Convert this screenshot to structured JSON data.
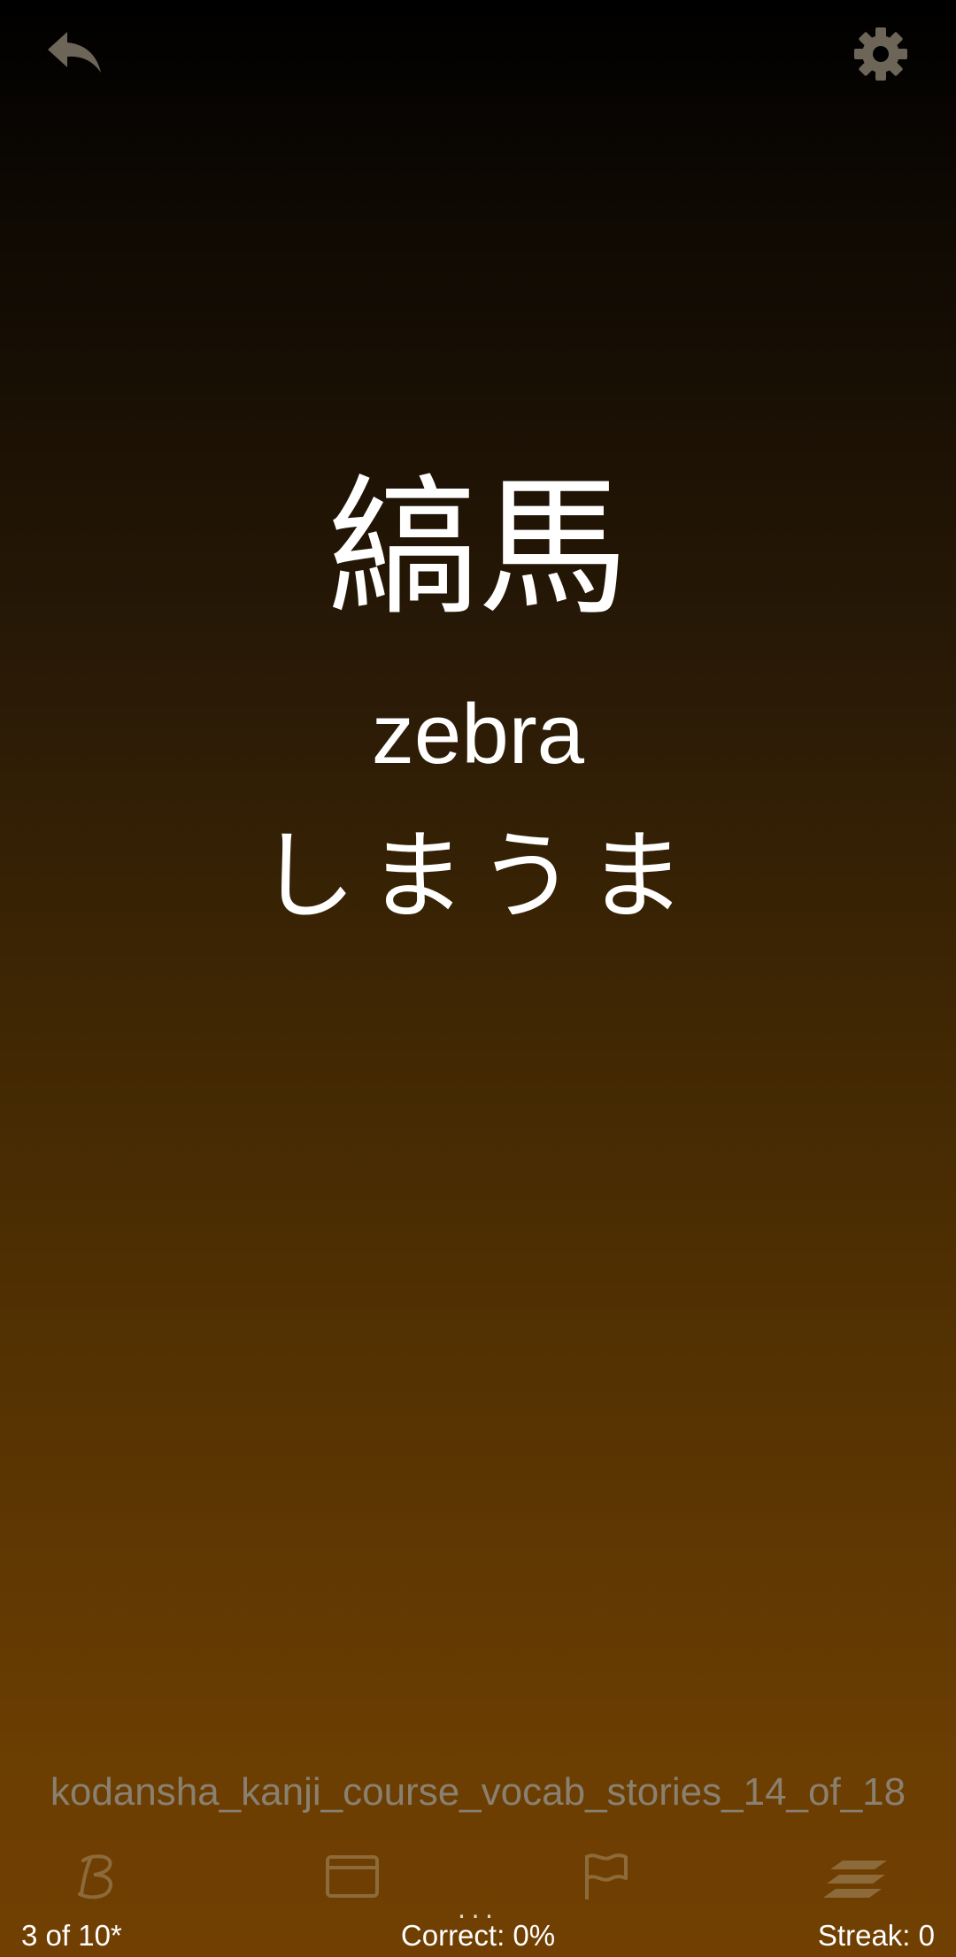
{
  "card": {
    "kanji": "縞馬",
    "meaning": "zebra",
    "reading": "しまうま"
  },
  "deck": {
    "name": "kodansha_kanji_course_vocab_stories_14_of_18"
  },
  "toolbar": {
    "icons": [
      "bold-b-icon",
      "card-icon",
      "flag-icon",
      "stack-icon"
    ],
    "more_indicator": "..."
  },
  "status": {
    "progress": "3 of 10*",
    "correct": "Correct: 0%",
    "streak": "Streak: 0"
  },
  "colors": {
    "icon_muted": "#6e6559",
    "toolbar_icon": "#8c6a3a",
    "deck_text": "#8a8070"
  }
}
